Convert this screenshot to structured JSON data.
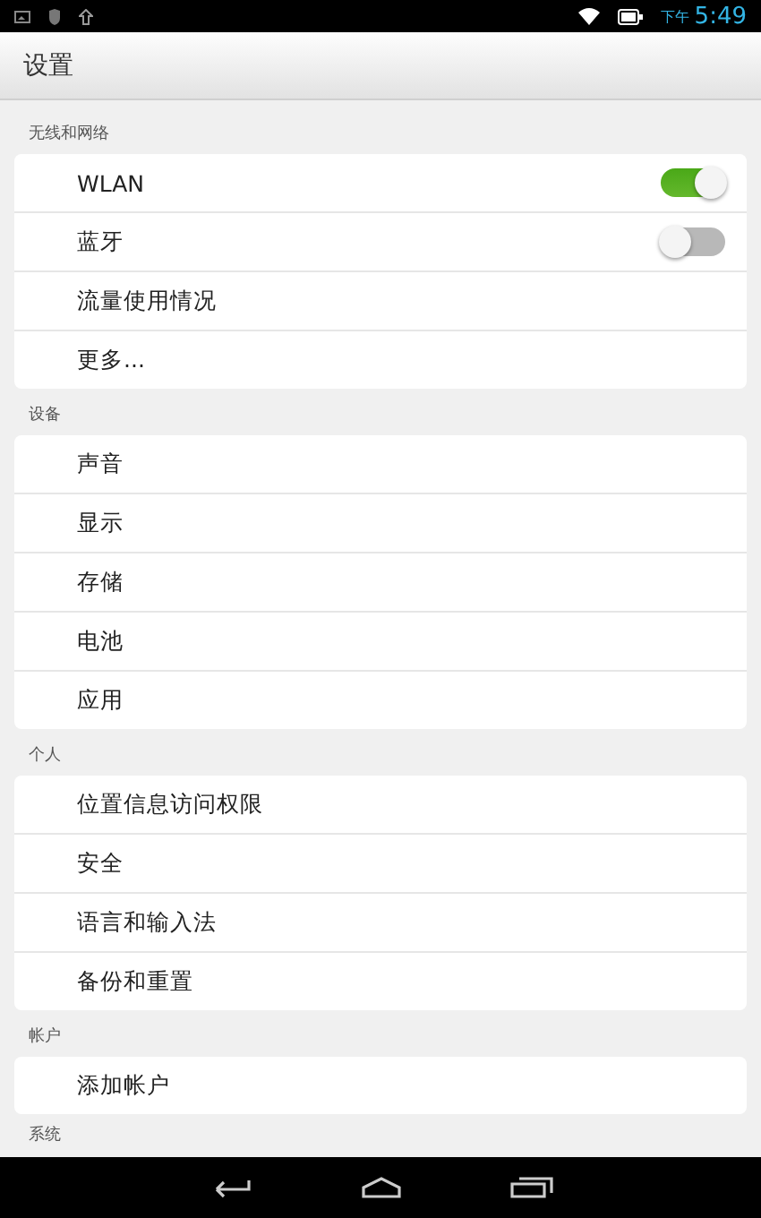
{
  "status_bar": {
    "period": "下午",
    "time": "5:49"
  },
  "title": "设置",
  "sections": [
    {
      "label": "无线和网络",
      "items": [
        {
          "label": "WLAN",
          "kind": "toggle",
          "on": true
        },
        {
          "label": "蓝牙",
          "kind": "toggle",
          "on": false
        },
        {
          "label": "流量使用情况",
          "kind": "plain"
        },
        {
          "label": "更多...",
          "kind": "plain"
        }
      ]
    },
    {
      "label": "设备",
      "items": [
        {
          "label": "声音",
          "kind": "plain"
        },
        {
          "label": "显示",
          "kind": "plain"
        },
        {
          "label": "存储",
          "kind": "plain"
        },
        {
          "label": "电池",
          "kind": "plain"
        },
        {
          "label": "应用",
          "kind": "plain"
        }
      ]
    },
    {
      "label": "个人",
      "items": [
        {
          "label": "位置信息访问权限",
          "kind": "plain"
        },
        {
          "label": "安全",
          "kind": "plain"
        },
        {
          "label": "语言和输入法",
          "kind": "plain"
        },
        {
          "label": "备份和重置",
          "kind": "plain"
        }
      ]
    },
    {
      "label": "帐户",
      "items": [
        {
          "label": "添加帐户",
          "kind": "plain"
        }
      ]
    },
    {
      "label": "系统"
    }
  ]
}
